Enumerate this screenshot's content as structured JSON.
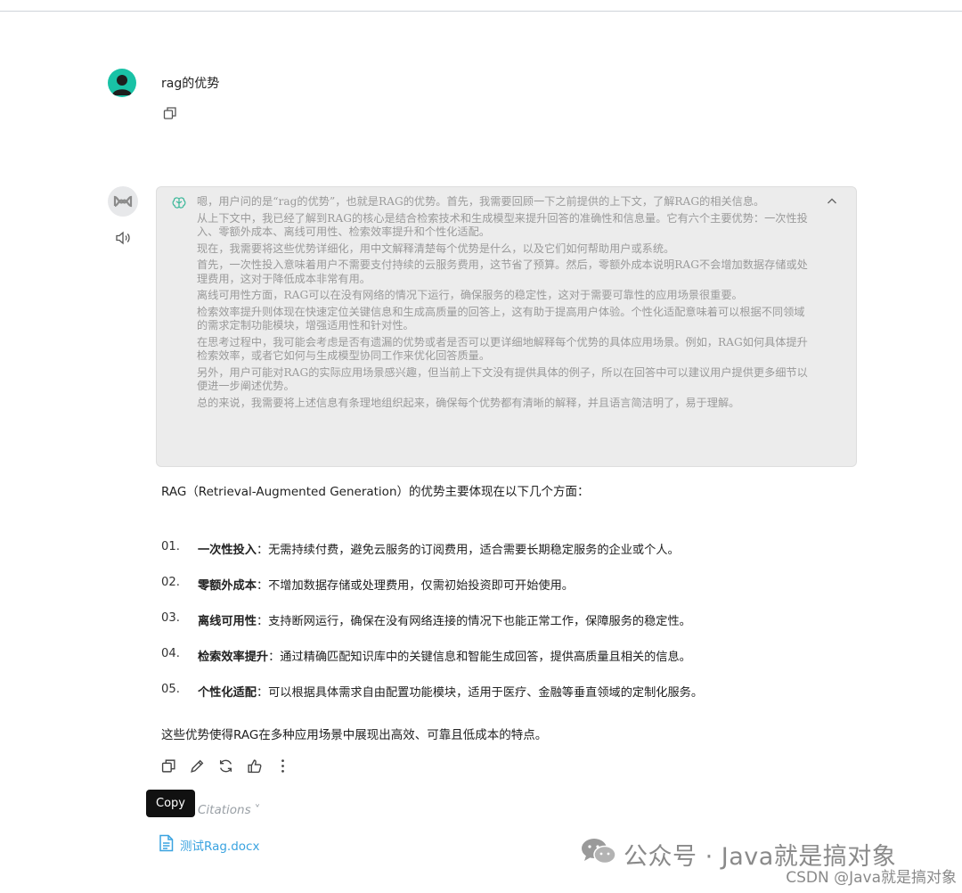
{
  "user": {
    "message": "rag的优势"
  },
  "thinking": {
    "paragraphs": [
      "嗯，用户问的是“rag的优势”，也就是RAG的优势。首先，我需要回顾一下之前提供的上下文，了解RAG的相关信息。",
      "从上下文中，我已经了解到RAG的核心是结合检索技术和生成模型来提升回答的准确性和信息量。它有六个主要优势：一次性投入、零额外成本、离线可用性、检索效率提升和个性化适配。",
      "现在，我需要将这些优势详细化，用中文解释清楚每个优势是什么，以及它们如何帮助用户或系统。",
      "首先，一次性投入意味着用户不需要支付持续的云服务费用，这节省了预算。然后，零额外成本说明RAG不会增加数据存储或处理费用，这对于降低成本非常有用。",
      "离线可用性方面，RAG可以在没有网络的情况下运行，确保服务的稳定性，这对于需要可靠性的应用场景很重要。",
      "检索效率提升则体现在快速定位关键信息和生成高质量的回答上，这有助于提高用户体验。个性化适配意味着可以根据不同领域的需求定制功能模块，增强适用性和针对性。",
      "在思考过程中，我可能会考虑是否有遗漏的优势或者是否可以更详细地解释每个优势的具体应用场景。例如，RAG如何具体提升检索效率，或者它如何与生成模型协同工作来优化回答质量。",
      "另外，用户可能对RAG的实际应用场景感兴趣，但当前上下文没有提供具体的例子，所以在回答中可以建议用户提供更多细节以便进一步阐述优势。",
      "总的来说，我需要将上述信息有条理地组织起来，确保每个优势都有清晰的解释，并且语言简洁明了，易于理解。"
    ]
  },
  "answer": {
    "intro": "RAG（Retrieval-Augmented Generation）的优势主要体现在以下几个方面：",
    "items": [
      {
        "num": "01.",
        "title": "一次性投入",
        "text": "：无需持续付费，避免云服务的订阅费用，适合需要长期稳定服务的企业或个人。"
      },
      {
        "num": "02.",
        "title": "零额外成本",
        "text": "：不增加数据存储或处理费用，仅需初始投资即可开始使用。"
      },
      {
        "num": "03.",
        "title": "离线可用性",
        "text": "：支持断网运行，确保在没有网络连接的情况下也能正常工作，保障服务的稳定性。"
      },
      {
        "num": "04.",
        "title": "检索效率提升",
        "text": "：通过精确匹配知识库中的关键信息和智能生成回答，提供高质量且相关的信息。"
      },
      {
        "num": "05.",
        "title": "个性化适配",
        "text": "：可以根据具体需求自由配置功能模块，适用于医疗、金融等垂直领域的定制化服务。"
      }
    ],
    "summary": "这些优势使得RAG在多种应用场景中展现出高效、可靠且低成本的特点。"
  },
  "actions": {
    "tooltip": "Copy",
    "icons": [
      "copy-icon",
      "edit-icon",
      "regenerate-icon",
      "thumbs-up-icon",
      "more-icon"
    ]
  },
  "citations": {
    "label": "Citations",
    "chevron": "˅",
    "file": "测试Rag.docx"
  },
  "watermark": {
    "main": "公众号 · Java就是搞对象",
    "sub": "CSDN @Java就是搞对象"
  },
  "colors": {
    "user_avatar": "#19c2a6",
    "thinking_bg": "#ececec",
    "link": "#3aa3e0"
  }
}
